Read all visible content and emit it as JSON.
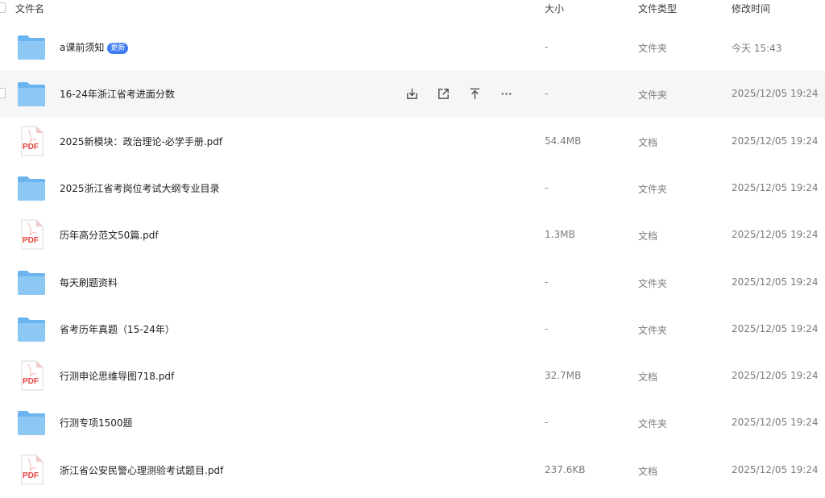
{
  "columns": {
    "name": "文件名",
    "size": "大小",
    "type": "文件类型",
    "mtime": "修改时间"
  },
  "badge_label": "更新",
  "rows": [
    {
      "name": "a课前须知",
      "icon": "folder-icon",
      "size": "-",
      "type": "文件夹",
      "mtime": "今天 15:43"
    },
    {
      "name": "16-24年浙江省考进面分数",
      "icon": "folder-icon",
      "size": "-",
      "type": "文件夹",
      "mtime": "2025/12/05 19:24"
    },
    {
      "name": "2025新模块：政治理论-必学手册.pdf",
      "icon": "pdf-icon",
      "size": "54.4MB",
      "type": "文档",
      "mtime": "2025/12/05 19:24"
    },
    {
      "name": "2025浙江省考岗位考试大纲专业目录",
      "icon": "folder-icon",
      "size": "-",
      "type": "文件夹",
      "mtime": "2025/12/05 19:24"
    },
    {
      "name": "历年高分范文50篇.pdf",
      "icon": "pdf-icon",
      "size": "1.3MB",
      "type": "文档",
      "mtime": "2025/12/05 19:24"
    },
    {
      "name": "每天刷题资料",
      "icon": "folder-icon",
      "size": "-",
      "type": "文件夹",
      "mtime": "2025/12/05 19:24"
    },
    {
      "name": "省考历年真题（15-24年）",
      "icon": "folder-icon",
      "size": "-",
      "type": "文件夹",
      "mtime": "2025/12/05 19:24"
    },
    {
      "name": "行测申论思维导图718.pdf",
      "icon": "pdf-icon",
      "size": "32.7MB",
      "type": "文档",
      "mtime": "2025/12/05 19:24"
    },
    {
      "name": "行测专项1500题",
      "icon": "folder-icon",
      "size": "-",
      "type": "文件夹",
      "mtime": "2025/12/05 19:24"
    },
    {
      "name": "浙江省公安民警心理测验考试题目.pdf",
      "icon": "pdf-icon",
      "size": "237.6KB",
      "type": "文档",
      "mtime": "2025/12/05 19:24"
    }
  ],
  "pdf_label": "PDF",
  "hover_actions": [
    "download-icon",
    "share-icon",
    "pin-top-icon",
    "more-icon"
  ],
  "colors": {
    "folder": "#6ab4f0",
    "pdf": "#e8413a",
    "badge": "#3f7cf2",
    "hover_row": "#f5f6f7"
  }
}
